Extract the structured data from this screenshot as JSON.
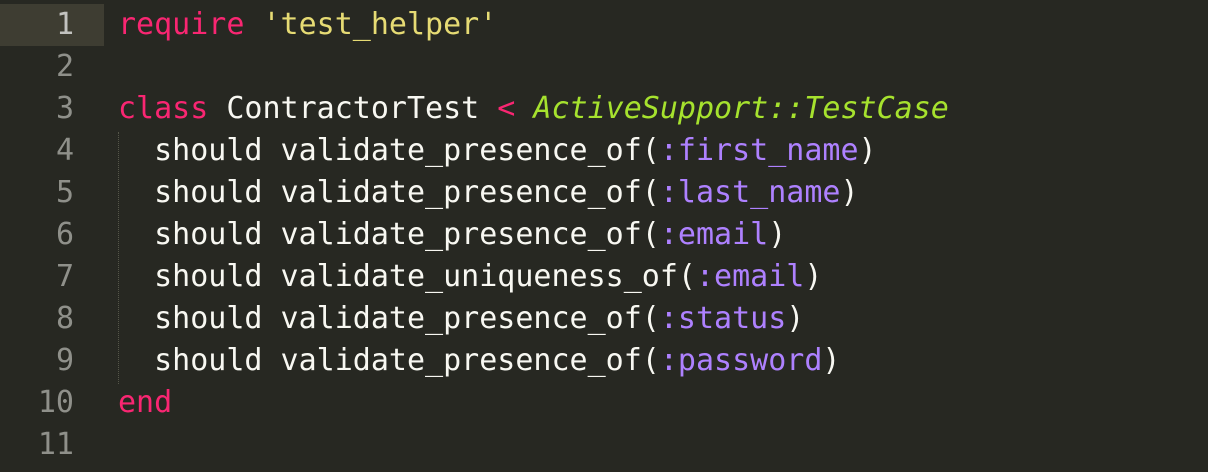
{
  "editor": {
    "theme_colors": {
      "background": "#272822",
      "current_line": "#3e3d32",
      "keyword": "#f92672",
      "string": "#e6db74",
      "class": "#a6e22e",
      "symbol": "#ae81ff",
      "text": "#f8f8f2",
      "line_number": "#8f908a"
    },
    "current_line": 1,
    "lines": [
      {
        "number": "1",
        "tokens": [
          {
            "t": "kw",
            "v": "require"
          },
          {
            "t": "plain",
            "v": " "
          },
          {
            "t": "str",
            "v": "'test_helper'"
          }
        ]
      },
      {
        "number": "2",
        "tokens": []
      },
      {
        "number": "3",
        "tokens": [
          {
            "t": "kw",
            "v": "class"
          },
          {
            "t": "plain",
            "v": " ContractorTest "
          },
          {
            "t": "op",
            "v": "<"
          },
          {
            "t": "plain",
            "v": " "
          },
          {
            "t": "class",
            "v": "ActiveSupport::TestCase"
          }
        ]
      },
      {
        "number": "4",
        "tokens": [
          {
            "t": "plain",
            "v": "  should validate_presence_of("
          },
          {
            "t": "sym",
            "v": ":first_name"
          },
          {
            "t": "plain",
            "v": ")"
          }
        ]
      },
      {
        "number": "5",
        "tokens": [
          {
            "t": "plain",
            "v": "  should validate_presence_of("
          },
          {
            "t": "sym",
            "v": ":last_name"
          },
          {
            "t": "plain",
            "v": ")"
          }
        ]
      },
      {
        "number": "6",
        "tokens": [
          {
            "t": "plain",
            "v": "  should validate_presence_of("
          },
          {
            "t": "sym",
            "v": ":email"
          },
          {
            "t": "plain",
            "v": ")"
          }
        ]
      },
      {
        "number": "7",
        "tokens": [
          {
            "t": "plain",
            "v": "  should validate_uniqueness_of("
          },
          {
            "t": "sym",
            "v": ":email"
          },
          {
            "t": "plain",
            "v": ")"
          }
        ]
      },
      {
        "number": "8",
        "tokens": [
          {
            "t": "plain",
            "v": "  should validate_presence_of("
          },
          {
            "t": "sym",
            "v": ":status"
          },
          {
            "t": "plain",
            "v": ")"
          }
        ]
      },
      {
        "number": "9",
        "tokens": [
          {
            "t": "plain",
            "v": "  should validate_presence_of("
          },
          {
            "t": "sym",
            "v": ":password"
          },
          {
            "t": "plain",
            "v": ")"
          }
        ]
      },
      {
        "number": "10",
        "tokens": [
          {
            "t": "kw",
            "v": "end"
          }
        ]
      },
      {
        "number": "11",
        "tokens": []
      }
    ]
  }
}
